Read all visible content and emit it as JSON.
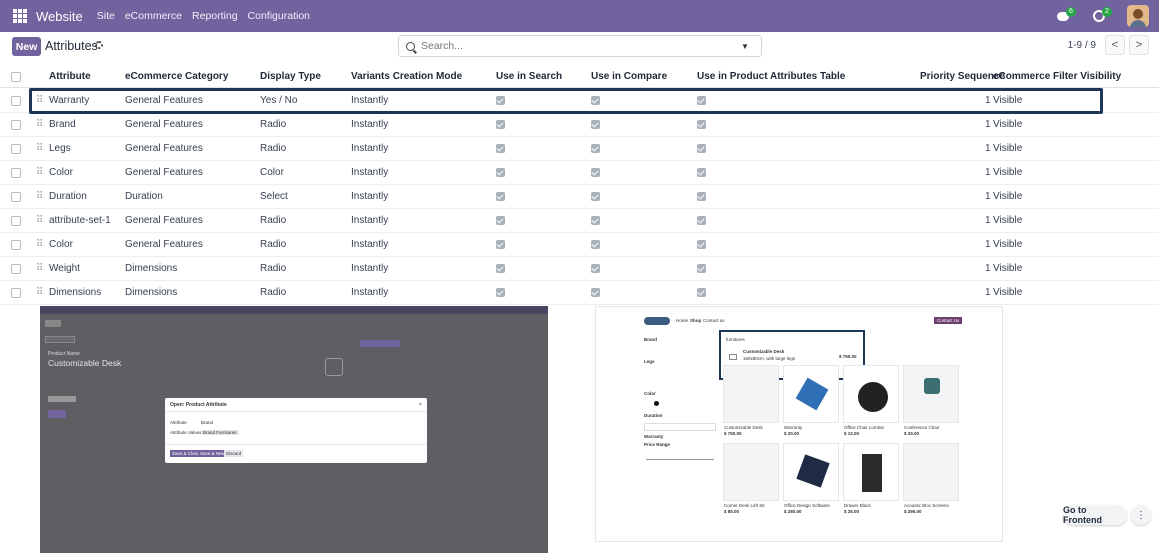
{
  "navbar": {
    "brand": "Website",
    "menus": [
      "Site",
      "eCommerce",
      "Reporting",
      "Configuration"
    ],
    "messages_count": "6",
    "activities_count": "2",
    "colors": {
      "bar": "#71639e"
    }
  },
  "control": {
    "new_label": "New",
    "breadcrumb": "Attributes",
    "search_placeholder": "Search...",
    "pager": "1-9 / 9",
    "prev": "<",
    "next": ">"
  },
  "table": {
    "headers": [
      "Attribute",
      "eCommerce Category",
      "Display Type",
      "Variants Creation Mode",
      "Use in Search",
      "Use in Compare",
      "Use in Product Attributes Table",
      "Priority Sequence",
      "eCommerce Filter Visibility"
    ],
    "rows": [
      {
        "attribute": "Warranty",
        "category": "General Features",
        "display": "Yes / No",
        "mode": "Instantly",
        "search": true,
        "compare": true,
        "table": true,
        "priority": "1",
        "visibility": "Visible"
      },
      {
        "attribute": "Brand",
        "category": "General Features",
        "display": "Radio",
        "mode": "Instantly",
        "search": true,
        "compare": true,
        "table": true,
        "priority": "1",
        "visibility": "Visible"
      },
      {
        "attribute": "Legs",
        "category": "General Features",
        "display": "Radio",
        "mode": "Instantly",
        "search": true,
        "compare": true,
        "table": true,
        "priority": "1",
        "visibility": "Visible"
      },
      {
        "attribute": "Color",
        "category": "General Features",
        "display": "Color",
        "mode": "Instantly",
        "search": true,
        "compare": true,
        "table": true,
        "priority": "1",
        "visibility": "Visible"
      },
      {
        "attribute": "Duration",
        "category": "Duration",
        "display": "Select",
        "mode": "Instantly",
        "search": true,
        "compare": true,
        "table": true,
        "priority": "1",
        "visibility": "Visible"
      },
      {
        "attribute": "attribute-set-1",
        "category": "General Features",
        "display": "Radio",
        "mode": "Instantly",
        "search": true,
        "compare": true,
        "table": true,
        "priority": "1",
        "visibility": "Visible"
      },
      {
        "attribute": "Color",
        "category": "General Features",
        "display": "Radio",
        "mode": "Instantly",
        "search": true,
        "compare": true,
        "table": true,
        "priority": "1",
        "visibility": "Visible"
      },
      {
        "attribute": "Weight",
        "category": "Dimensions",
        "display": "Radio",
        "mode": "Instantly",
        "search": true,
        "compare": true,
        "table": true,
        "priority": "1",
        "visibility": "Visible"
      },
      {
        "attribute": "Dimensions",
        "category": "Dimensions",
        "display": "Radio",
        "mode": "Instantly",
        "search": true,
        "compare": true,
        "table": true,
        "priority": "1",
        "visibility": "Visible"
      }
    ]
  },
  "left_screenshot": {
    "product_name_label": "Product Name",
    "product_name": "Customizable Desk",
    "dialog_title": "Open: Product Attribute",
    "attribute_label": "Attribute",
    "attribute_value": "Brand",
    "values_label": "Attribute Values",
    "values_tag": "Brand Furnitures",
    "btn_save_close": "Save & Close",
    "btn_save_new": "Save & New",
    "btn_discard": "Discard"
  },
  "right_screenshot": {
    "nav_links": [
      "Home",
      "Shop",
      "Contact us"
    ],
    "contact_button": "Contact Us",
    "search_text": "furnitures",
    "suggestion_title": "Customizable Desk",
    "suggestion_desc": "160x80cm, with large legs",
    "suggestion_price": "$ 750.00",
    "filters": [
      "Brand",
      "Legs",
      "Color",
      "Duration",
      "Warranty",
      "Price Range"
    ],
    "products": [
      {
        "name": "Customizable Desk",
        "price": "$ 750.00"
      },
      {
        "name": "Warranty",
        "price": "$ 20.00"
      },
      {
        "name": "Office Chair Lumbar",
        "price": "$ 12.00"
      },
      {
        "name": "Conference Chair",
        "price": "$ 33.00"
      },
      {
        "name": "Corner Desk Left Sit",
        "price": "$ 85.00"
      },
      {
        "name": "Office Design Software",
        "price": "$ 280.00"
      },
      {
        "name": "Drawer Black",
        "price": "$ 25.00"
      },
      {
        "name": "Acoustic Bloc Screens",
        "price": "$ 295.00"
      }
    ]
  },
  "go_to_frontend": "Go to Frontend"
}
